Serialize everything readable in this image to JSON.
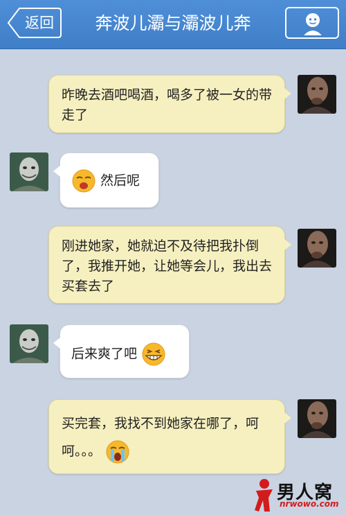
{
  "header": {
    "back_label": "返回",
    "title": "奔波儿灞与灞波儿奔",
    "profile_icon": "person-icon",
    "background": "#4a8ad5"
  },
  "messages": [
    {
      "side": "right",
      "text": "昨晚去酒吧喝酒，喝多了被一女的带走了"
    },
    {
      "side": "left",
      "text": "然后呢",
      "emoji": "sleepy-face-emoji"
    },
    {
      "side": "right",
      "text": "刚进她家，她就迫不及待把我扑倒了，我推开她，让她等会儿，我出去买套去了"
    },
    {
      "side": "left",
      "text": "后来爽了吧",
      "emoji": "grinning-face-emoji"
    },
    {
      "side": "right",
      "text": "买完套，我找不到她家在哪了，呵呵。。。",
      "emoji": "crying-face-emoji"
    }
  ],
  "watermark": {
    "name": "男人窝",
    "url": "nrwowo.com"
  }
}
